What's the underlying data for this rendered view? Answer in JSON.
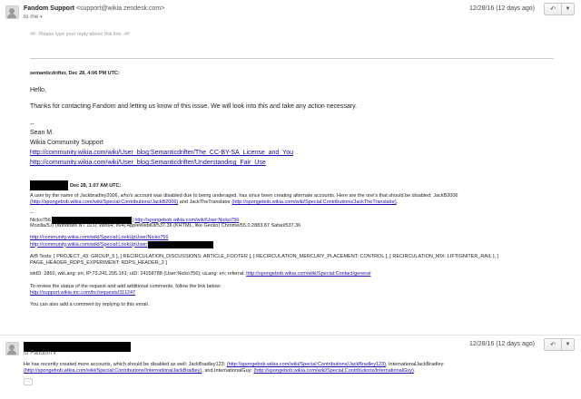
{
  "message1": {
    "sender_name": "Fandom Support",
    "sender_email": "<support@wikia.zendesk.com>",
    "to": "to me",
    "date": "12/28/16 (12 days ago)",
    "reply_line": "##- Please type your reply above this line -##",
    "agent_comment_header": "semanticdrifter, Dec 28, 4:06 PM UTC:",
    "greeting": "Hello,",
    "thanks": "Thanks for contacting Fandom and letting us know of this issue. We will look into this and take any action necessary.",
    "sig_dashes": "--",
    "sig_name": "Sean M.",
    "sig_title": "Wikia Community Support",
    "sig_link1": "http://community.wikia.com/wiki/User_blog:Semanticdrifter/The_CC-BY-SA_License_and_You",
    "sig_link2": "http://community.wikia.com/wiki/User_blog:Semanticdrifter/Understanding_Fair_Use",
    "user_comment_header": "Dec 28, 1:07 AM UTC:",
    "report_text": "A user by the name of Jackbradley2006, who's account was disabled due to being underaged, has since been creating alternate accounts. Here are the one's that should be disabled: JackB2006",
    "report_link1": "(http://spongebob.wikia.com/wiki/Special:Contributions/JackB2006)",
    "report_mid": "and JackTheTranslator",
    "report_link2": "(http://spongebob.wikia.com/wiki/Special:Contributions/JackTheTranslator)",
    "report_end": ".",
    "dash": "--",
    "nicko": "Nicko756",
    "nicko_link": "http://spongebob.wikia.com/wiki/User:Nicko756",
    "nicko_sep": "|",
    "ua": "Mozilla/5.0 (Windows NT 10.0; Win64; x64) AppleWebKit/537.36 (KHTML, like Gecko) Chrome/55.0.2883.87 Safari/537.36",
    "lookup1": "http://community.wikia.com/wiki/Special:LookUpUser/Nicko756",
    "lookup2": "http://community.wikia.com/wiki/Special:LookUpUser/",
    "ab_tests": "A/B Tests: [ PROJECT_43: GROUP_5 ], [ RECIRCULATION_DISCUSSIONS: ARTICLE_FOOTER ], [ RECIRCULATION_MERCURY_PLACEMENT: CONTROL ], [ RECIRCULATION_MIX: LIFTIGNITER_RAIL ], [ PAGE_HEADER_RDPS_EXPERIMENT: RDPS_HEADER_2 ]",
    "wiki_info": "wkID: 2860, wkLang: en; IP:73.241.205.161; uID: 24158788 (User:Nicko756); uLang: en; referral:",
    "referral_link": "http://spongebob.wikia.com/wiki/Special:Contact/general",
    "review_text": "To review the status of the request and add additional comments, follow the link below:",
    "review_link": "http://support.wikia-inc.com/hc/requests/311247",
    "add_comment": "You can also add a comment by replying to this email."
  },
  "message2": {
    "to": "to Fandom",
    "date": "12/28/16 (12 days ago)",
    "text_a": "He has recently created more accounts, which should be disabled as well: JackBradley123:",
    "link_a": "(http://spongebob.wikia.com/wiki/Special:Contributions/JackBradley123)",
    "text_b": ", InternationalJackBradley:",
    "link_b": "(http://spongebob.wikia.com/wiki/Special:Contributions/InternationalJackBradley)",
    "text_c": ", and InternationalGuy:",
    "link_c": "(http://spongebob.wikia.com/wiki/Special:Contributions/InternationalGuy)",
    "text_d": ".",
    "ellipsis": "..."
  },
  "icons": {
    "reply": "reply-arrow-icon",
    "more": "chevron-down-icon",
    "avatar": "person-avatar-icon"
  }
}
